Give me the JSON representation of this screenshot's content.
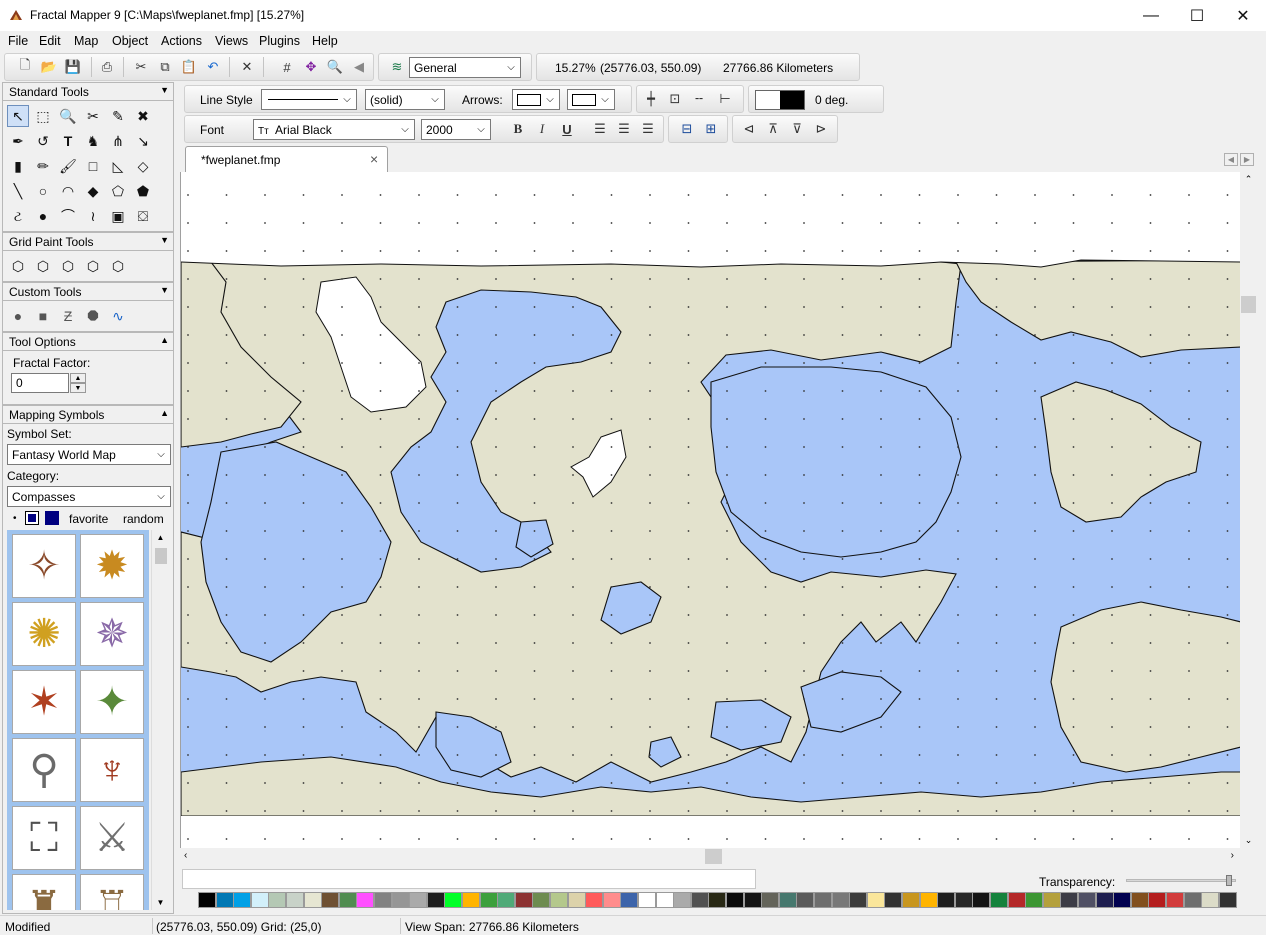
{
  "window": {
    "title": "Fractal Mapper 9 [C:\\Maps\\fweplanet.fmp] [15.27%]",
    "minimize": "—",
    "maximize": "☐",
    "close": "✕"
  },
  "menu": [
    "File",
    "Edit",
    "Map",
    "Object",
    "Actions",
    "Views",
    "Plugins",
    "Help"
  ],
  "toolbar": {
    "layer_select": "General",
    "zoom": "15.27%",
    "coords": "(25776.03, 550.09)",
    "view_span": "27766.86 Kilometers"
  },
  "style_bar": {
    "line_style_label": "Line Style",
    "line_pattern": "(solid)",
    "arrows_label": "Arrows:",
    "rotation": "0 deg.",
    "font_label": "Font",
    "font_value": "Arial Black",
    "font_size": "2000",
    "bold": "B",
    "italic": "I",
    "underline": "U"
  },
  "panels": {
    "standard_tools": "Standard Tools",
    "grid_paint_tools": "Grid Paint Tools",
    "custom_tools": "Custom Tools",
    "tool_options": "Tool Options",
    "fractal_factor_label": "Fractal Factor:",
    "fractal_factor_value": "0",
    "mapping_symbols": "Mapping Symbols",
    "symbol_set_label": "Symbol Set:",
    "symbol_set_value": "Fantasy World Map",
    "category_label": "Category:",
    "category_value": "Compasses",
    "favorite": "favorite",
    "random": "random"
  },
  "document": {
    "tab_label": "*fweplanet.fmp",
    "tab_close": "×"
  },
  "palette": {
    "transparency_label": "Transparency:",
    "transparency_value": 0.95,
    "colors": [
      "#000000",
      "#0078b4",
      "#00a0e6",
      "#d2f0fa",
      "#b4c8b4",
      "#c8d2c8",
      "#e6e6d2",
      "#6e5032",
      "#508c50",
      "#ff50ff",
      "#828282",
      "#969696",
      "#aaaaaa",
      "#1e1e1e",
      "#00ff28",
      "#ffb400",
      "#3ca03c",
      "#50aa78",
      "#8c3232",
      "#6e8c50",
      "#b4c88c",
      "#dcd2aa",
      "#ff5a5a",
      "#ff8c8c",
      "#3c64aa",
      "#ffffff",
      "#ffffff",
      "#aaaaaa",
      "#505050",
      "#282814",
      "#0a0a0a",
      "#141414",
      "#64645a",
      "#46786e",
      "#5a5a5a",
      "#6e6e6e",
      "#787878",
      "#3c3c3c",
      "#fae69b",
      "#323232",
      "#c8961e",
      "#ffb400",
      "#1e1e1e",
      "#282828",
      "#141414",
      "#14823c",
      "#b42828",
      "#3c9632",
      "#b4a03c",
      "#3c3c46",
      "#505064",
      "#1e1e50",
      "#000050",
      "#82501e",
      "#b41e1e",
      "#d23c3c",
      "#6e6e6e",
      "#dcdcc8",
      "#323232"
    ]
  },
  "status": {
    "state": "Modified",
    "coords_grid": "(25776.03, 550.09) Grid: (25,0)",
    "view_span": "View Span: 27766.86 Kilometers"
  },
  "colors": {
    "ocean": "#a9c6f8",
    "land": "#e3e2cd",
    "snow": "#ffffff"
  }
}
